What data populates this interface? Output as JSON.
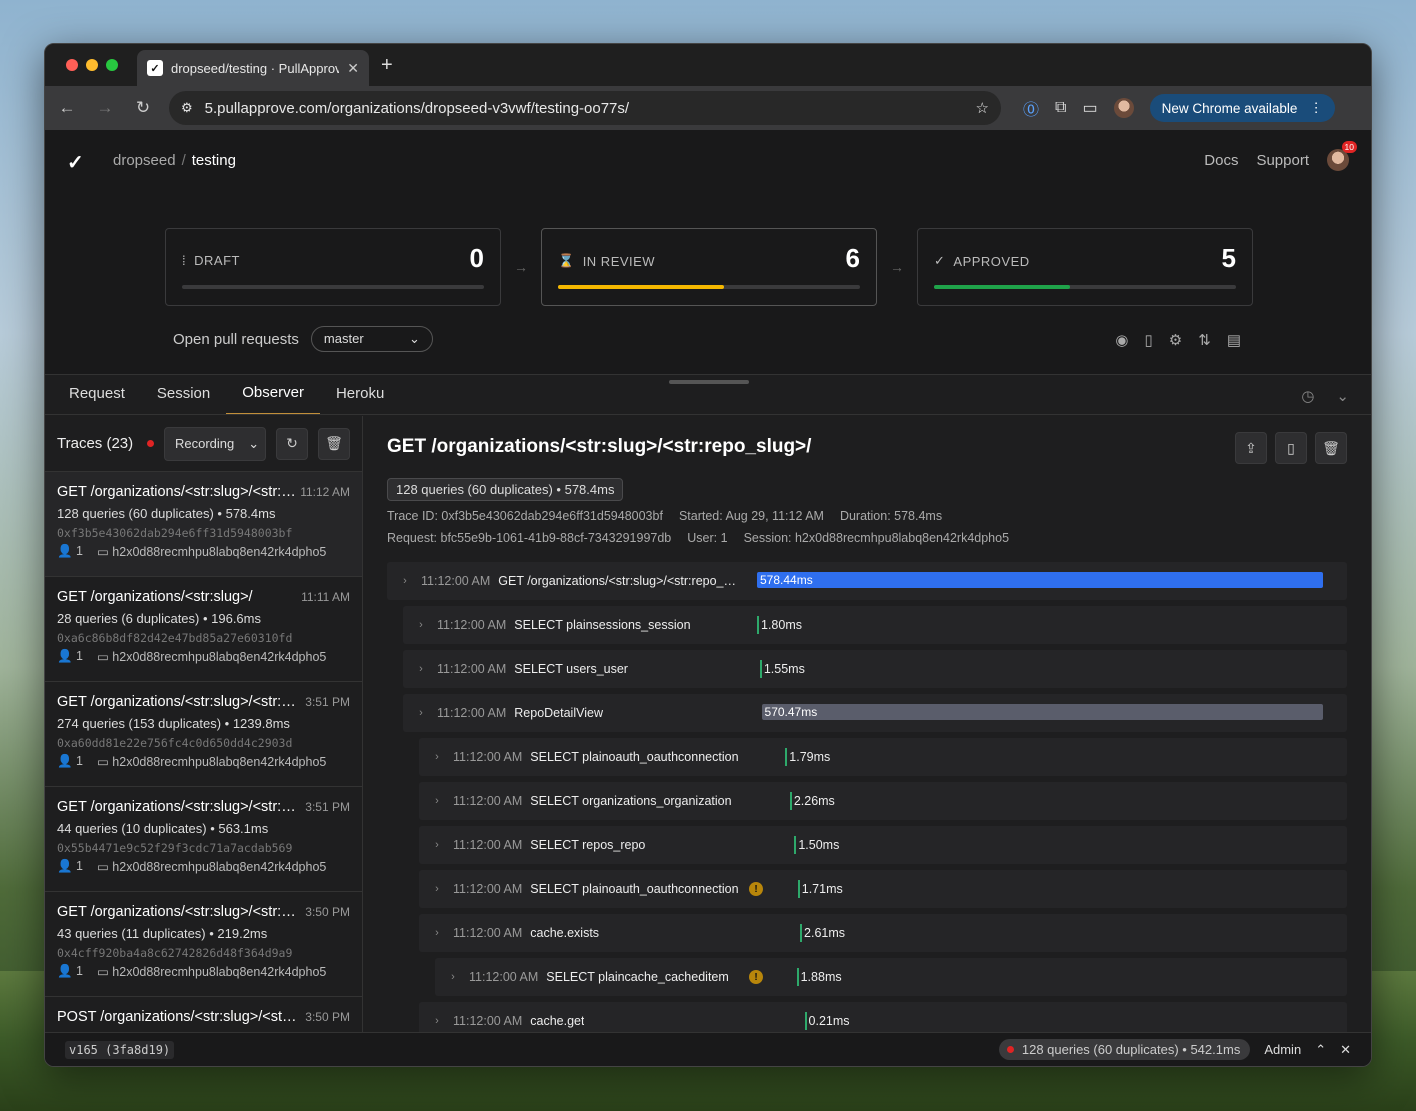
{
  "browser": {
    "tab_title": "dropseed/testing · PullApprove",
    "url": "5.pullapprove.com/organizations/dropseed-v3vwf/testing-oo77s/",
    "new_chrome": "New Chrome available"
  },
  "header": {
    "org": "dropseed",
    "repo": "testing",
    "docs": "Docs",
    "support": "Support",
    "notifications": "10"
  },
  "cards": [
    {
      "label": "DRAFT",
      "count": "0",
      "progress": 0,
      "color": "#3a3a3c"
    },
    {
      "label": "IN REVIEW",
      "count": "6",
      "progress": 0.55,
      "color": "#f5b800"
    },
    {
      "label": "APPROVED",
      "count": "5",
      "progress": 0.45,
      "color": "#1fa34a"
    }
  ],
  "pull_requests": {
    "label": "Open pull requests",
    "branch": "master"
  },
  "panel_tabs": [
    "Request",
    "Session",
    "Observer",
    "Heroku"
  ],
  "sidebar": {
    "title": "Traces (23)",
    "recording": "Recording",
    "traces": [
      {
        "path": "GET /organizations/<str:slug>/<str:repo_slug>/",
        "time": "11:12 AM",
        "meta": "128 queries (60 duplicates) • 578.4ms",
        "hash": "0xf3b5e43062dab294e6ff31d5948003bf",
        "user": "1",
        "session": "h2x0d88recmhpu8labq8en42rk4dpho5"
      },
      {
        "path": "GET /organizations/<str:slug>/",
        "time": "11:11 AM",
        "meta": "28 queries (6 duplicates) • 196.6ms",
        "hash": "0xa6c86b8df82d42e47bd85a27e60310fd",
        "user": "1",
        "session": "h2x0d88recmhpu8labq8en42rk4dpho5"
      },
      {
        "path": "GET /organizations/<str:slug>/<str:repo_slug>/",
        "time": "3:51 PM",
        "meta": "274 queries (153 duplicates) • 1239.8ms",
        "hash": "0xa60dd81e22e756fc4c0d650dd4c2903d",
        "user": "1",
        "session": "h2x0d88recmhpu8labq8en42rk4dpho5"
      },
      {
        "path": "GET /organizations/<str:slug>/<str:repo_slug>/",
        "time": "3:51 PM",
        "meta": "44 queries (10 duplicates) • 563.1ms",
        "hash": "0x55b4471e9c52f29f3cdc71a7acdab569",
        "user": "1",
        "session": "h2x0d88recmhpu8labq8en42rk4dpho5"
      },
      {
        "path": "GET /organizations/<str:slug>/<str:repo_slug>/",
        "time": "3:50 PM",
        "meta": "43 queries (11 duplicates) • 219.2ms",
        "hash": "0x4cff920ba4a8c62742826d48f364d9a9",
        "user": "1",
        "session": "h2x0d88recmhpu8labq8en42rk4dpho5"
      },
      {
        "path": "POST /organizations/<str:slug>/<str:repo_slug>/",
        "time": "3:50 PM",
        "meta": "",
        "hash": "",
        "user": "",
        "session": ""
      }
    ]
  },
  "detail": {
    "title": "GET /organizations/<str:slug>/<str:repo_slug>/",
    "badge": "128 queries (60 duplicates) • 578.4ms",
    "trace_id": "Trace ID: 0xf3b5e43062dab294e6ff31d5948003bf",
    "started": "Started: Aug 29, 11:12 AM",
    "duration": "Duration: 578.4ms",
    "request": "Request: bfc55e9b-1061-41b9-88cf-7343291997db",
    "user": "User: 1",
    "session": "Session: h2x0d88recmhpu8labq8en42rk4dpho5",
    "spans": [
      {
        "time": "11:12:00 AM",
        "name": "GET /organizations/<str:slug>/<str:repo_slug>/",
        "dur": "578.44ms",
        "depth": 0,
        "start": 0.0,
        "frac": 1.0,
        "kind": "bar",
        "color": "#2f6fef",
        "warn": false
      },
      {
        "time": "11:12:00 AM",
        "name": "SELECT plainsessions_session",
        "dur": "1.80ms",
        "depth": 1,
        "start": 0.0,
        "frac": 0.0031,
        "kind": "tick",
        "warn": false
      },
      {
        "time": "11:12:00 AM",
        "name": "SELECT users_user",
        "dur": "1.55ms",
        "depth": 1,
        "start": 0.005,
        "frac": 0.0027,
        "kind": "tick",
        "warn": false
      },
      {
        "time": "11:12:00 AM",
        "name": "RepoDetailView",
        "dur": "570.47ms",
        "depth": 1,
        "start": 0.008,
        "frac": 0.992,
        "kind": "bar",
        "color": "#5a5d6b",
        "warn": false
      },
      {
        "time": "11:12:00 AM",
        "name": "SELECT plainoauth_oauthconnection",
        "dur": "1.79ms",
        "depth": 2,
        "start": 0.05,
        "frac": 0.0031,
        "kind": "tick",
        "warn": false
      },
      {
        "time": "11:12:00 AM",
        "name": "SELECT organizations_organization",
        "dur": "2.26ms",
        "depth": 2,
        "start": 0.058,
        "frac": 0.0039,
        "kind": "tick",
        "warn": false
      },
      {
        "time": "11:12:00 AM",
        "name": "SELECT repos_repo",
        "dur": "1.50ms",
        "depth": 2,
        "start": 0.066,
        "frac": 0.0026,
        "kind": "tick",
        "warn": false
      },
      {
        "time": "11:12:00 AM",
        "name": "SELECT plainoauth_oauthconnection",
        "dur": "1.71ms",
        "depth": 2,
        "start": 0.072,
        "frac": 0.003,
        "kind": "tick",
        "warn": true
      },
      {
        "time": "11:12:00 AM",
        "name": "cache.exists",
        "dur": "2.61ms",
        "depth": 2,
        "start": 0.076,
        "frac": 0.0045,
        "kind": "tick",
        "warn": false
      },
      {
        "time": "11:12:00 AM",
        "name": "SELECT plaincache_cacheditem",
        "dur": "1.88ms",
        "depth": 3,
        "start": 0.07,
        "frac": 0.0033,
        "kind": "tick",
        "warn": true
      },
      {
        "time": "11:12:00 AM",
        "name": "cache.get",
        "dur": "0.21ms",
        "depth": 2,
        "start": 0.084,
        "frac": 0.0004,
        "kind": "tick",
        "warn": false
      }
    ]
  },
  "footer": {
    "version": "v165 (3fa8d19)",
    "status": "128 queries (60 duplicates) • 542.1ms",
    "admin": "Admin"
  }
}
